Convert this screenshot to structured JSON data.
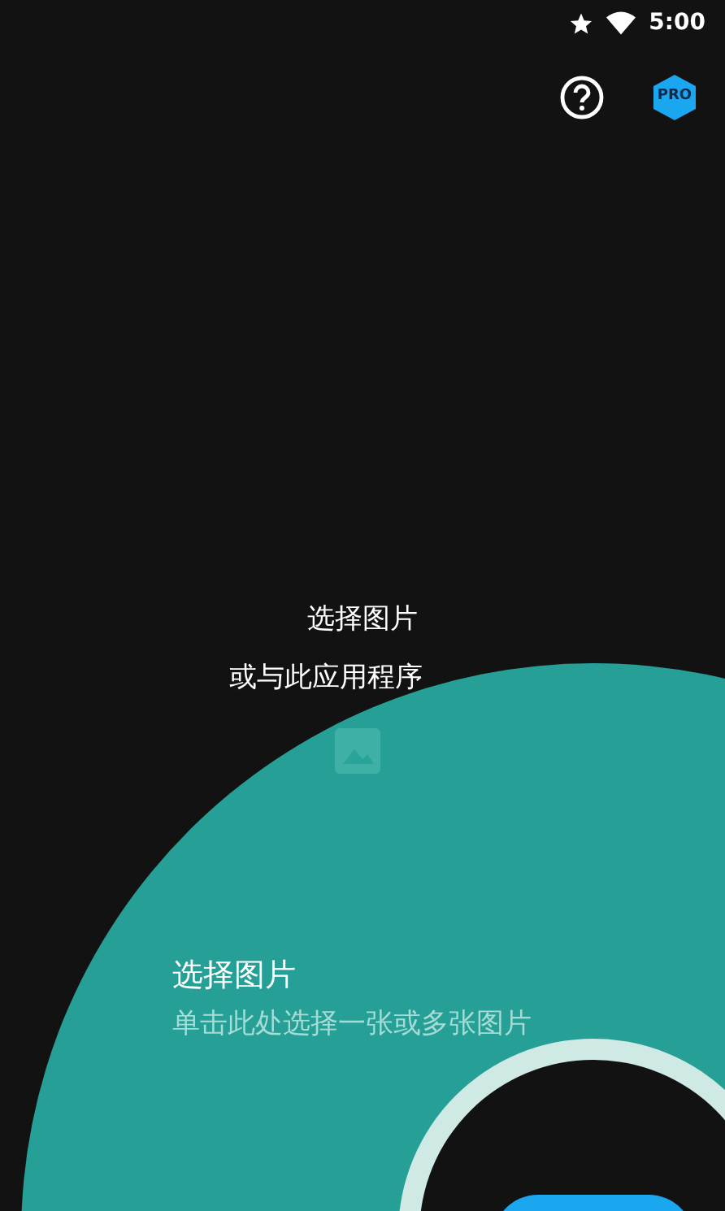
{
  "status_bar": {
    "time": "5:00"
  },
  "toolbar": {
    "pro_badge": "PRO"
  },
  "empty_state": {
    "title": "选择图片",
    "subtitle": "或与此应用程序"
  },
  "tutorial": {
    "title": "选择图片",
    "description": "单击此处选择一张或多张图片"
  }
}
